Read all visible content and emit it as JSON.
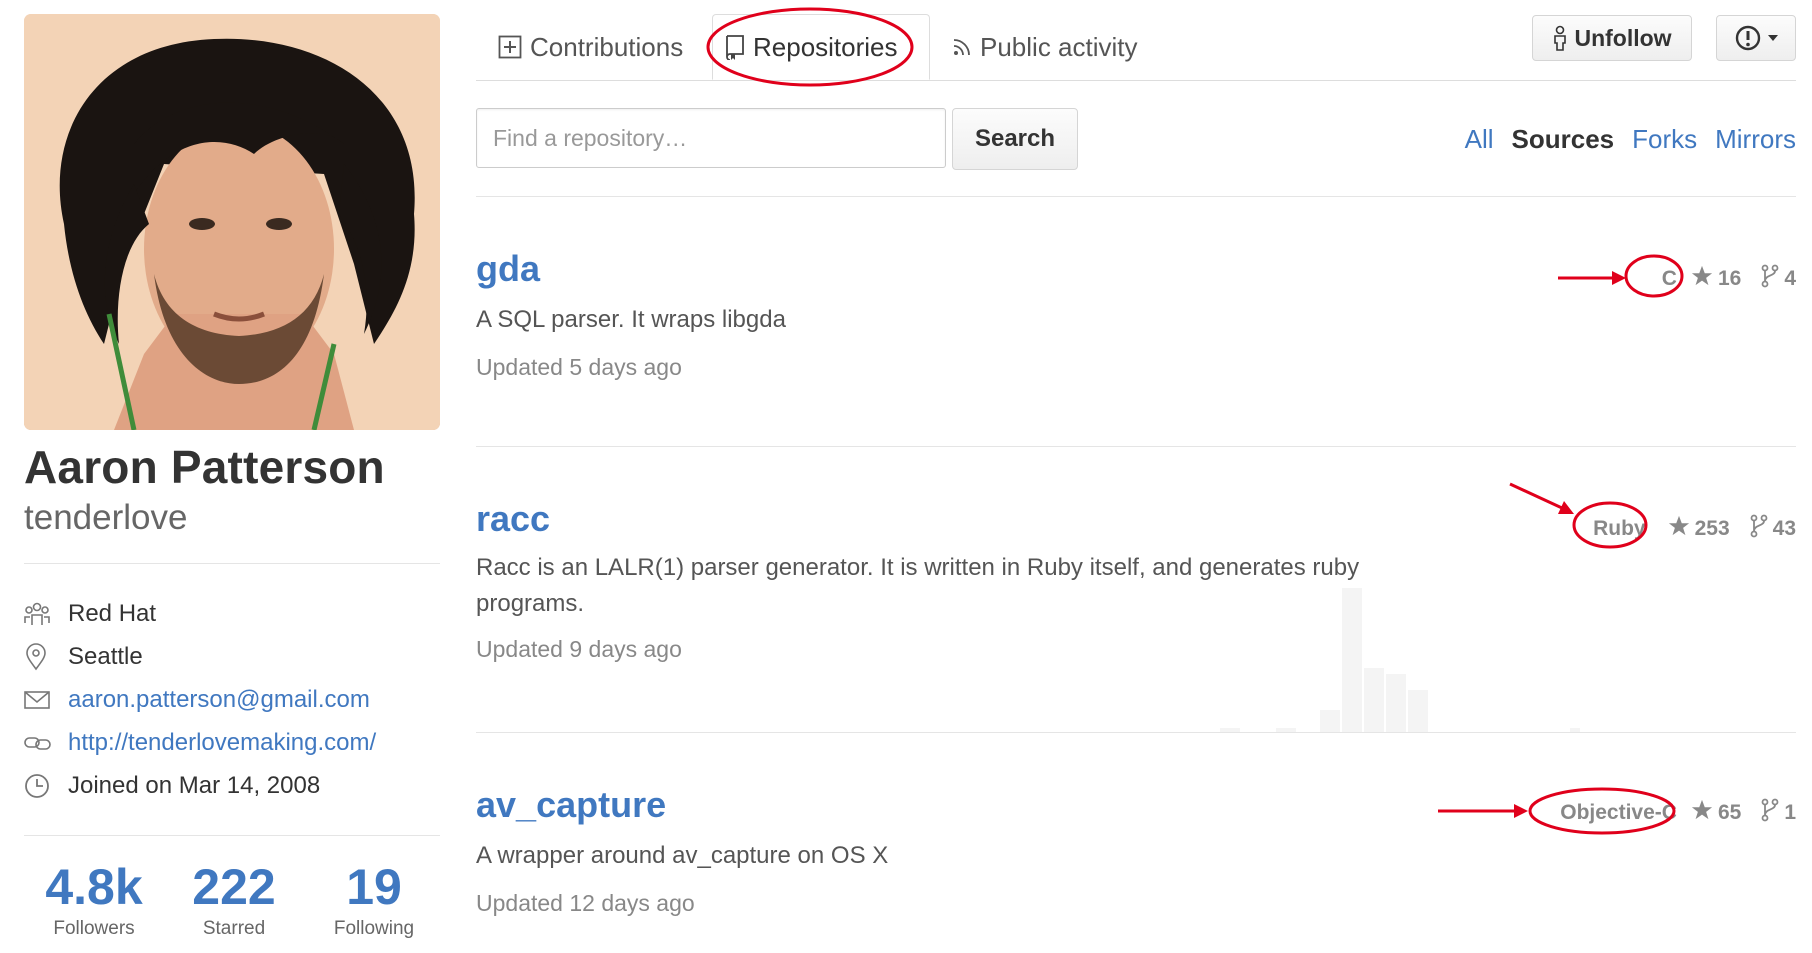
{
  "profile": {
    "full_name": "Aaron Patterson",
    "username": "tenderlove",
    "details": [
      {
        "icon": "organization-icon",
        "text": "Red Hat",
        "link": false
      },
      {
        "icon": "location-icon",
        "text": "Seattle",
        "link": false
      },
      {
        "icon": "mail-icon",
        "text": "aaron.patterson@gmail.com",
        "link": true
      },
      {
        "icon": "link-icon",
        "text": "http://tenderlovemaking.com/",
        "link": true
      },
      {
        "icon": "clock-icon",
        "text": "Joined on Mar 14, 2008",
        "link": false
      }
    ],
    "stats": [
      {
        "value": "4.8k",
        "label": "Followers"
      },
      {
        "value": "222",
        "label": "Starred"
      },
      {
        "value": "19",
        "label": "Following"
      }
    ]
  },
  "tabs": {
    "contributions": "Contributions",
    "repositories": "Repositories",
    "public_activity": "Public activity",
    "selected": "Repositories"
  },
  "actions": {
    "unfollow": "Unfollow"
  },
  "search": {
    "placeholder": "Find a repository…",
    "button": "Search"
  },
  "filters": {
    "all": "All",
    "sources": "Sources",
    "forks": "Forks",
    "mirrors": "Mirrors",
    "active": "Sources"
  },
  "repos": [
    {
      "name": "gda",
      "description": "A SQL parser. It wraps libgda",
      "updated": "Updated 5 days ago",
      "language": "C",
      "stars": "16",
      "forks": "4"
    },
    {
      "name": "racc",
      "description": "Racc is an LALR(1) parser generator. It is written in Ruby itself, and generates ruby programs.",
      "updated": "Updated 9 days ago",
      "language": "Ruby",
      "stars": "253",
      "forks": "43"
    },
    {
      "name": "av_capture",
      "description": "A wrapper around av_capture on OS X",
      "updated": "Updated 12 days ago",
      "language": "Objective-C",
      "stars": "65",
      "forks": "1"
    }
  ],
  "colors": {
    "link": "#4078c0",
    "annotation": "#e0001b",
    "text": "#333333",
    "muted": "#888888"
  }
}
